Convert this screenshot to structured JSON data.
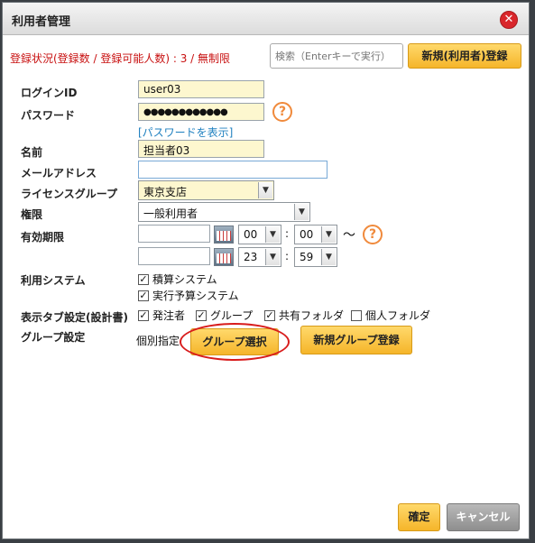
{
  "dialog": {
    "title": "利用者管理"
  },
  "header": {
    "status": "登録状況(登録数 / 登録可能人数) : 3 / 無制限",
    "search_placeholder": "検索（Enterキーで実行）",
    "new_user_button": "新規(利用者)登録"
  },
  "form": {
    "login_id": {
      "label": "ログインID",
      "value": "user03"
    },
    "password": {
      "label": "パスワード",
      "value": "●●●●●●●●●●●●",
      "show_link": "[パスワードを表示]"
    },
    "name": {
      "label": "名前",
      "value": "担当者03"
    },
    "email": {
      "label": "メールアドレス",
      "value": ""
    },
    "license_group": {
      "label": "ライセンスグループ",
      "value": "東京支店"
    },
    "permission": {
      "label": "権限",
      "value": "一般利用者"
    },
    "validity": {
      "label": "有効期限",
      "from": {
        "hour": "00",
        "minute": "00"
      },
      "to": {
        "hour": "23",
        "minute": "59"
      },
      "separator": ":",
      "tilde": "〜"
    },
    "systems": {
      "label": "利用システム",
      "items": [
        {
          "label": "積算システム",
          "checked": true
        },
        {
          "label": "実行予算システム",
          "checked": true
        }
      ]
    },
    "display_tabs": {
      "label": "表示タブ設定(設計書)",
      "items": [
        {
          "label": "発注者",
          "checked": true
        },
        {
          "label": "グループ",
          "checked": true
        },
        {
          "label": "共有フォルダ",
          "checked": true
        },
        {
          "label": "個人フォルダ",
          "checked": false
        }
      ]
    },
    "group_setting": {
      "label": "グループ設定",
      "mode": "個別指定",
      "select_button": "グループ選択",
      "new_group_button": "新規グループ登録"
    }
  },
  "footer": {
    "confirm": "確定",
    "cancel": "キャンセル"
  },
  "icons": {
    "close": "close-icon",
    "help": "help-icon",
    "calendar": "calendar-icon",
    "chevron": "chevron-down-icon"
  },
  "colors": {
    "accent": "#f5b52a",
    "status_text": "#c81010",
    "highlight_ellipse": "#d81c1c"
  }
}
